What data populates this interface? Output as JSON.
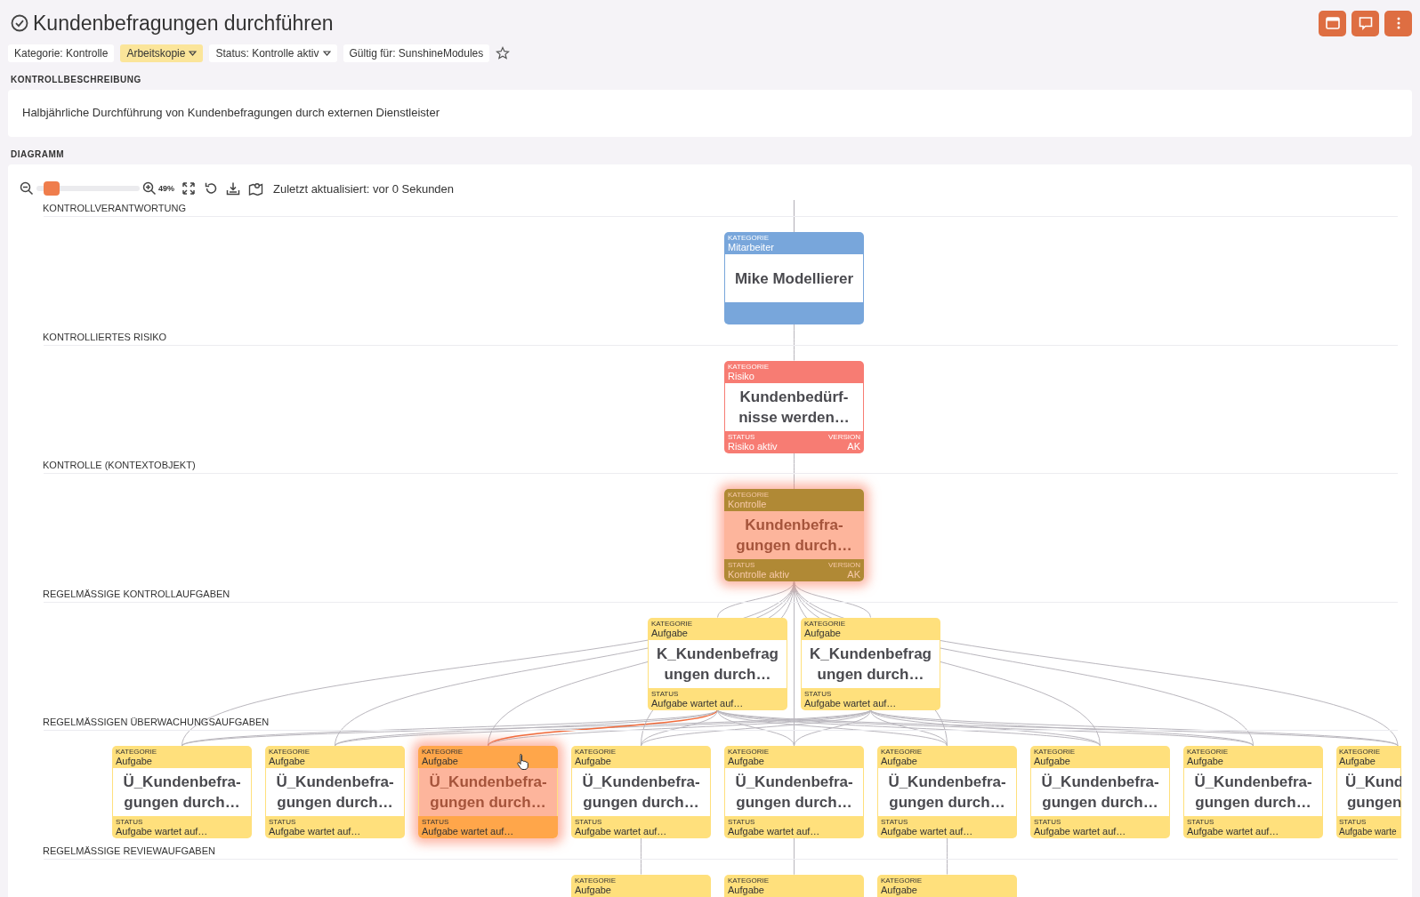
{
  "title": "Kundenbefragungen durchführen",
  "header_buttons": [
    {
      "kind": "window"
    },
    {
      "kind": "comment"
    },
    {
      "kind": "more"
    }
  ],
  "chips": [
    {
      "label": "Kategorie: Kontrolle",
      "dropdown": false,
      "highlighted": false
    },
    {
      "label": "Arbeitskopie",
      "dropdown": true,
      "highlighted": true
    },
    {
      "label": "Status: Kontrolle aktiv",
      "dropdown": true,
      "highlighted": false
    },
    {
      "label": "Gültig für: SunshineModules",
      "dropdown": false,
      "highlighted": false
    }
  ],
  "favorite": false,
  "description": {
    "heading": "KONTROLLBESCHREIBUNG",
    "text": "Halbjährliche Durchführung von Kundenbefragungen durch externen Dienstleister"
  },
  "diagram": {
    "heading": "DIAGRAMM",
    "toolbar": {
      "level": 0.15,
      "zoom_reading": "49%",
      "last_updated": "Zuletzt aktualisiert: vor 0 Sekunden"
    },
    "lanes": [
      {
        "label": "KONTROLLVERANTWORTUNG",
        "nodes": [
          {
            "kind": "mitarbeiter",
            "category_caption": "KATEGORIE",
            "category": "Mitarbeiter",
            "title_lines": [
              "Mike Modellierer"
            ],
            "highlighted": false
          }
        ]
      },
      {
        "label": "KONTROLLIERTES RISIKO",
        "nodes": [
          {
            "kind": "risiko",
            "category_caption": "KATEGORIE",
            "category": "Risiko",
            "title_lines": [
              "Kundenbedürf-",
              "nisse werden…"
            ],
            "status_caption": "STATUS",
            "status": "Risiko aktiv",
            "version_caption": "VERSION",
            "version": "AK",
            "highlighted": false
          }
        ]
      },
      {
        "label": "KONTROLLE (KONTEXTOBJEKT)",
        "nodes": [
          {
            "kind": "kontrolle",
            "category_caption": "KATEGORIE",
            "category": "Kontrolle",
            "title_lines": [
              "Kundenbefra-",
              "gungen durch…"
            ],
            "status_caption": "STATUS",
            "status": "Kontrolle aktiv",
            "version_caption": "VERSION",
            "version": "AK",
            "highlighted": true
          }
        ]
      },
      {
        "label": "REGELMÄSSIGE KONTROLLAUFGABEN",
        "nodes": [
          {
            "kind": "aufgabe",
            "category_caption": "KATEGORIE",
            "category": "Aufgabe",
            "title_lines": [
              "K_Kundenbefrag",
              "ungen durch…"
            ],
            "status_caption": "STATUS",
            "status": "Aufgabe wartet auf…",
            "highlighted": false
          },
          {
            "kind": "aufgabe",
            "category_caption": "KATEGORIE",
            "category": "Aufgabe",
            "title_lines": [
              "K_Kundenbefrag",
              "ungen durch…"
            ],
            "status_caption": "STATUS",
            "status": "Aufgabe wartet auf…",
            "highlighted": false
          }
        ]
      },
      {
        "label": "REGELMÄSSIGEN ÜBERWACHUNGSAUFGABEN",
        "nodes": [
          {
            "kind": "aufgabe",
            "category_caption": "KATEGORIE",
            "category": "Aufgabe",
            "title_lines": [
              "Ü_Kundenbefra-",
              "gungen durch…"
            ],
            "status_caption": "STATUS",
            "status": "Aufgabe wartet auf…",
            "highlighted": false
          },
          {
            "kind": "aufgabe",
            "category_caption": "KATEGORIE",
            "category": "Aufgabe",
            "title_lines": [
              "Ü_Kundenbefra-",
              "gungen durch…"
            ],
            "status_caption": "STATUS",
            "status": "Aufgabe wartet auf…",
            "highlighted": false
          },
          {
            "kind": "aufgabe",
            "category_caption": "KATEGORIE",
            "category": "Aufgabe",
            "title_lines": [
              "Ü_Kundenbefra-",
              "gungen durch…"
            ],
            "status_caption": "STATUS",
            "status": "Aufgabe wartet auf…",
            "highlighted": true
          },
          {
            "kind": "aufgabe",
            "category_caption": "KATEGORIE",
            "category": "Aufgabe",
            "title_lines": [
              "Ü_Kundenbefra-",
              "gungen durch…"
            ],
            "status_caption": "STATUS",
            "status": "Aufgabe wartet auf…",
            "highlighted": false
          },
          {
            "kind": "aufgabe",
            "category_caption": "KATEGORIE",
            "category": "Aufgabe",
            "title_lines": [
              "Ü_Kundenbefra-",
              "gungen durch…"
            ],
            "status_caption": "STATUS",
            "status": "Aufgabe wartet auf…",
            "highlighted": false
          },
          {
            "kind": "aufgabe",
            "category_caption": "KATEGORIE",
            "category": "Aufgabe",
            "title_lines": [
              "Ü_Kundenbefra-",
              "gungen durch…"
            ],
            "status_caption": "STATUS",
            "status": "Aufgabe wartet auf…",
            "highlighted": false
          },
          {
            "kind": "aufgabe",
            "category_caption": "KATEGORIE",
            "category": "Aufgabe",
            "title_lines": [
              "Ü_Kundenbefra-",
              "gungen durch…"
            ],
            "status_caption": "STATUS",
            "status": "Aufgabe wartet auf…",
            "highlighted": false
          },
          {
            "kind": "aufgabe",
            "category_caption": "KATEGORIE",
            "category": "Aufgabe",
            "title_lines": [
              "Ü_Kundenbefra-",
              "gungen durch…"
            ],
            "status_caption": "STATUS",
            "status": "Aufgabe wartet auf…",
            "highlighted": false
          },
          {
            "kind": "aufgabe",
            "category_caption": "KATEGORIE",
            "category": "Aufgabe",
            "title_lines": [
              "Ü_Kund",
              "gungen"
            ],
            "status_caption": "STATUS",
            "status": "Aufgabe warte",
            "highlighted": false
          }
        ]
      },
      {
        "label": "REGELMÄSSIGE REVIEWAUFGABEN",
        "nodes": [
          {
            "kind": "aufgabe",
            "category_caption": "KATEGORIE",
            "category": "Aufgabe",
            "highlighted": false
          },
          {
            "kind": "aufgabe",
            "category_caption": "KATEGORIE",
            "category": "Aufgabe",
            "highlighted": false
          },
          {
            "kind": "aufgabe",
            "category_caption": "KATEGORIE",
            "category": "Aufgabe",
            "highlighted": false
          }
        ]
      }
    ]
  }
}
